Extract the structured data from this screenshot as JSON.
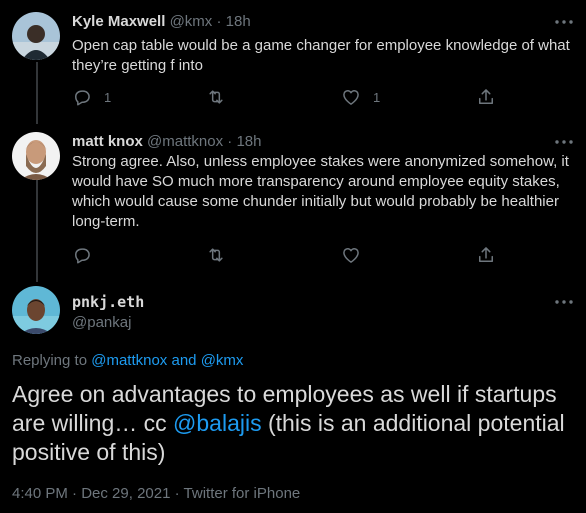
{
  "colors": {
    "background": "#000000",
    "text": "#d9d9d9",
    "muted": "#6e767d",
    "link": "#1d9bf0",
    "thread_line": "#333639"
  },
  "tweets": [
    {
      "name": "Kyle Maxwell",
      "handle": "@kmx",
      "separator": "·",
      "time": "18h",
      "text": "Open cap table would be a game changer for employee knowledge of what they’re getting f into",
      "reply_count": "1",
      "retweet_count": "",
      "like_count": "1",
      "avatar_icon": "user-avatar"
    },
    {
      "name": "matt knox",
      "handle": "@mattknox",
      "separator": "·",
      "time": "18h",
      "text": "Strong agree.  Also, unless employee stakes were anonymized somehow, it would have SO much more transparency around employee equity stakes, which would cause some chunder initially but would probably be healthier long-term.",
      "reply_count": "",
      "retweet_count": "",
      "like_count": "",
      "avatar_icon": "user-avatar"
    }
  ],
  "focused": {
    "name": "pnkj.eth",
    "handle": "@pankaj",
    "replying_prefix": "Replying to",
    "replying_user1": "@mattknox",
    "replying_and": "and",
    "replying_user2": "@kmx",
    "text_before": "Agree on advantages to employees as well if startups are willing… cc",
    "mention": "@balajis",
    "text_after": "(this is an additional potential positive of this)",
    "time": "4:40 PM",
    "date": "Dec 29, 2021",
    "separator": "·",
    "source": "Twitter for iPhone"
  },
  "icons": {
    "reply": "reply-icon",
    "retweet": "retweet-icon",
    "like": "heart-icon",
    "share": "share-icon",
    "more": "more-icon"
  }
}
